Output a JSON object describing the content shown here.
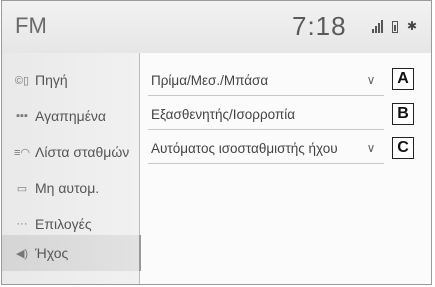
{
  "header": {
    "title": "FM",
    "clock": "7:18",
    "bluetooth_glyph": "✱"
  },
  "sidebar": {
    "items": [
      {
        "label": "Πηγή",
        "icon": "source-icon",
        "glyph": "©▯"
      },
      {
        "label": "Αγαπημένα",
        "icon": "favorites-icon",
        "glyph": "▪▪▪"
      },
      {
        "label": "Λίστα σταθμών",
        "icon": "station-list-icon",
        "glyph": "≡◠"
      },
      {
        "label": "Μη αυτομ.",
        "icon": "manual-tuning-icon",
        "glyph": "▭"
      },
      {
        "label": "Επιλογές",
        "icon": "options-icon",
        "glyph": "···"
      },
      {
        "label": "Ήχος",
        "icon": "speaker-icon",
        "glyph": "◀)"
      }
    ],
    "active_index": 5
  },
  "sound_settings": {
    "rows": [
      {
        "label": "Πρίμα/Μεσ./Μπάσα",
        "has_dropdown": true,
        "callout": "A"
      },
      {
        "label": "Εξασθενητής/Ισορροπία",
        "has_dropdown": false,
        "callout": "B"
      },
      {
        "label": "Αυτόματος ισοσταθμιστής ήχου",
        "has_dropdown": true,
        "callout": "C"
      }
    ],
    "chevron_glyph": "∨"
  },
  "colors": {
    "header_bg": "#e6e6e6",
    "sidebar_bg": "#ececec",
    "active_bg": "#d8d8d8",
    "text": "#444444"
  }
}
